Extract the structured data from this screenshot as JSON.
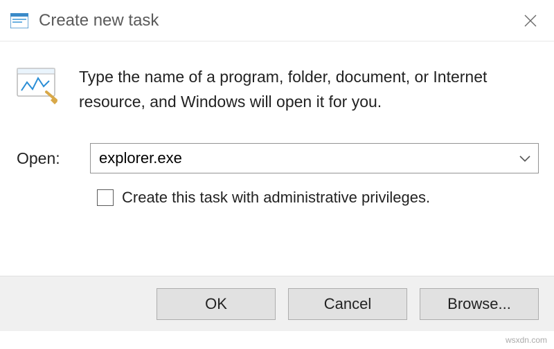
{
  "titlebar": {
    "title": "Create new task"
  },
  "content": {
    "info_text": "Type the name of a program, folder, document, or Internet resource, and Windows will open it for you."
  },
  "open": {
    "label": "Open:",
    "value": "explorer.exe"
  },
  "admin": {
    "label": "Create this task with administrative privileges.",
    "checked": false
  },
  "buttons": {
    "ok": "OK",
    "cancel": "Cancel",
    "browse": "Browse..."
  },
  "watermark": "wsxdn.com"
}
